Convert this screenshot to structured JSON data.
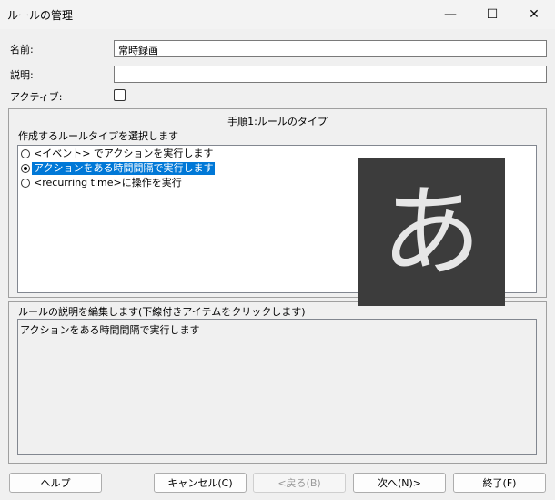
{
  "window": {
    "title": "ルールの管理",
    "minimize": "—",
    "maximize": "☐",
    "close": "✕"
  },
  "form": {
    "name_label": "名前:",
    "name_value": "常時録画",
    "desc_label": "説明:",
    "desc_value": "",
    "active_label": "アクティブ:",
    "active_checked": false
  },
  "step": {
    "heading": "手順1:ルールのタイプ",
    "select_label": "作成するルールタイプを選択します",
    "options": [
      {
        "label": "<イベント> でアクションを実行します",
        "selected": false
      },
      {
        "label": "アクションをある時間間隔で実行します",
        "selected": true
      },
      {
        "label": "<recurring time>に操作を実行",
        "selected": false
      }
    ]
  },
  "description": {
    "label": "ルールの説明を編集します(下線付きアイテムをクリックします)",
    "text": "アクションをある時間間隔で実行します"
  },
  "ime_indicator": "あ",
  "buttons": {
    "help": "ヘルプ",
    "cancel": "キャンセル(C)",
    "back": "<戻る(B)",
    "next": "次へ(N)>",
    "finish": "終了(F)"
  }
}
